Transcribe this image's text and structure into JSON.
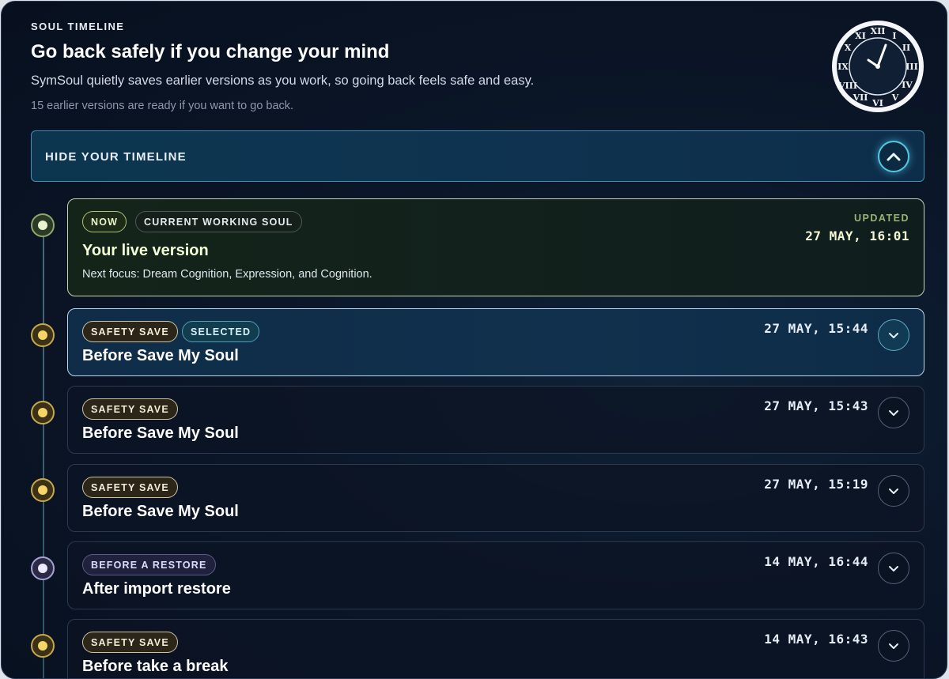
{
  "header": {
    "eyebrow": "SOUL TIMELINE",
    "title": "Go back safely if you change your mind",
    "subtitle": "SymSoul quietly saves earlier versions as you work, so going back feels safe and easy.",
    "count_text": "15 earlier versions are ready if you want to go back."
  },
  "toggle": {
    "label": "HIDE YOUR TIMELINE",
    "icon": "chevron-up-icon"
  },
  "live": {
    "badges": [
      "NOW",
      "CURRENT WORKING SOUL"
    ],
    "title": "Your live version",
    "description": "Next focus: Dream Cognition, Expression, and Cognition.",
    "updated_label": "UPDATED",
    "timestamp": "27 MAY, 16:01"
  },
  "entries": [
    {
      "badge": "SAFETY SAVE",
      "badge2": "SELECTED",
      "title": "Before Save My Soul",
      "timestamp": "27 MAY, 15:44"
    },
    {
      "badge": "SAFETY SAVE",
      "title": "Before Save My Soul",
      "timestamp": "27 MAY, 15:43"
    },
    {
      "badge": "SAFETY SAVE",
      "title": "Before Save My Soul",
      "timestamp": "27 MAY, 15:19"
    },
    {
      "badge": "BEFORE A RESTORE",
      "title": "After import restore",
      "timestamp": "14 MAY, 16:44"
    },
    {
      "badge": "SAFETY SAVE",
      "title": "Before take a break",
      "timestamp": "14 MAY, 16:43"
    }
  ],
  "colors": {
    "accent": "#55c6e6",
    "live": "#a7c47a",
    "save": "#f6d467",
    "restore": "#a6a3d4"
  }
}
